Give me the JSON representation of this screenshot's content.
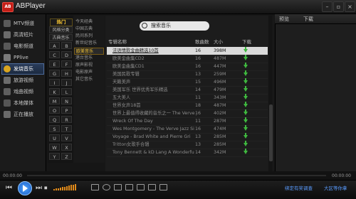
{
  "app": {
    "title": "ABPlayer",
    "logo_text": "AB",
    "min_symbol": "–",
    "max_symbol": "▫",
    "close_symbol": "×"
  },
  "leftnav": {
    "items": [
      {
        "label": "MTV频道",
        "active": false
      },
      {
        "label": "高清短片",
        "active": false
      },
      {
        "label": "电影频道",
        "active": false
      },
      {
        "label": "PPlive",
        "active": false
      },
      {
        "label": "发烧音乐",
        "active": true
      },
      {
        "label": "旅游视频",
        "active": false
      },
      {
        "label": "戏曲视频",
        "active": false
      },
      {
        "label": "本地媒体",
        "active": false
      },
      {
        "label": "正在播放",
        "active": false
      }
    ]
  },
  "letters": {
    "hot": "热门",
    "cats": [
      "风格分类",
      "古典音乐"
    ],
    "grid": [
      "A",
      "B",
      "C",
      "D",
      "E",
      "F",
      "G",
      "H",
      "I",
      "J",
      "K",
      "L",
      "M",
      "N",
      "O",
      "P",
      "Q",
      "R",
      "S",
      "T",
      "U",
      "V",
      "W",
      "X",
      "Y",
      "Z"
    ]
  },
  "subcats": {
    "items": [
      {
        "label": "今天经典",
        "active": false
      },
      {
        "label": "中国古典",
        "active": false
      },
      {
        "label": "民间系列",
        "active": false
      },
      {
        "label": "新世纪音乐",
        "active": false
      },
      {
        "label": "欧美音乐",
        "active": true
      },
      {
        "label": "港台音乐",
        "active": false
      },
      {
        "label": "原声影视",
        "active": false
      },
      {
        "label": "电影原声",
        "active": false
      },
      {
        "label": "其它音乐",
        "active": false
      }
    ]
  },
  "search": {
    "placeholder": "搜索音乐"
  },
  "table": {
    "headers": {
      "name": "专辑名称",
      "count": "歌曲数",
      "size": "大小",
      "download": "下载"
    },
    "rows": [
      {
        "name": "法语情歌金曲精选10首",
        "count": "16",
        "size": "398M",
        "selected": true
      },
      {
        "name": "欧美金曲集CD2",
        "count": "16",
        "size": "487M",
        "selected": false
      },
      {
        "name": "欧美金曲集CD1",
        "count": "16",
        "size": "447M",
        "selected": false
      },
      {
        "name": "美国民歌专辑",
        "count": "13",
        "size": "259M",
        "selected": false
      },
      {
        "name": "天籁美声",
        "count": "15",
        "size": "496M",
        "selected": false
      },
      {
        "name": "美国军乐 世界优秀军乐精选",
        "count": "14",
        "size": "479M",
        "selected": false
      },
      {
        "name": "五大美人",
        "count": "11",
        "size": "343M",
        "selected": false
      },
      {
        "name": "世界女声18首",
        "count": "18",
        "size": "487M",
        "selected": false
      },
      {
        "name": "世界上最值得收藏的音乐之一 The Verve Jazz Si DS",
        "count": "16",
        "size": "402M",
        "selected": false
      },
      {
        "name": "Wreck Of The Day",
        "count": "11",
        "size": "287M",
        "selected": false
      },
      {
        "name": "Wes Montgomery - The Verve Jazz Si",
        "count": "16",
        "size": "474M",
        "selected": false
      },
      {
        "name": "Voyage - Brad White and Pierre Gri",
        "count": "13",
        "size": "285M",
        "selected": false
      },
      {
        "name": "Tritton女歌手合辑",
        "count": "13",
        "size": "285M",
        "selected": false
      },
      {
        "name": "Tony Bennett & kD Lang A Wonderfu",
        "count": "14",
        "size": "342M",
        "selected": false
      }
    ]
  },
  "rightpanel": {
    "col1": "预览",
    "col2": "下载"
  },
  "player": {
    "time_start": "00:00:00",
    "time_end": "00:00:00",
    "link1": "绑定有奖调查",
    "link2": "大区等你拿",
    "prev_symbol": "⏮",
    "next_symbol": "⏭",
    "stop_symbol": "⏹"
  },
  "colors": {
    "accent": "#ffcc33",
    "play": "#2d7fe0",
    "download": "#3fb83f",
    "link": "#5a9cff"
  }
}
